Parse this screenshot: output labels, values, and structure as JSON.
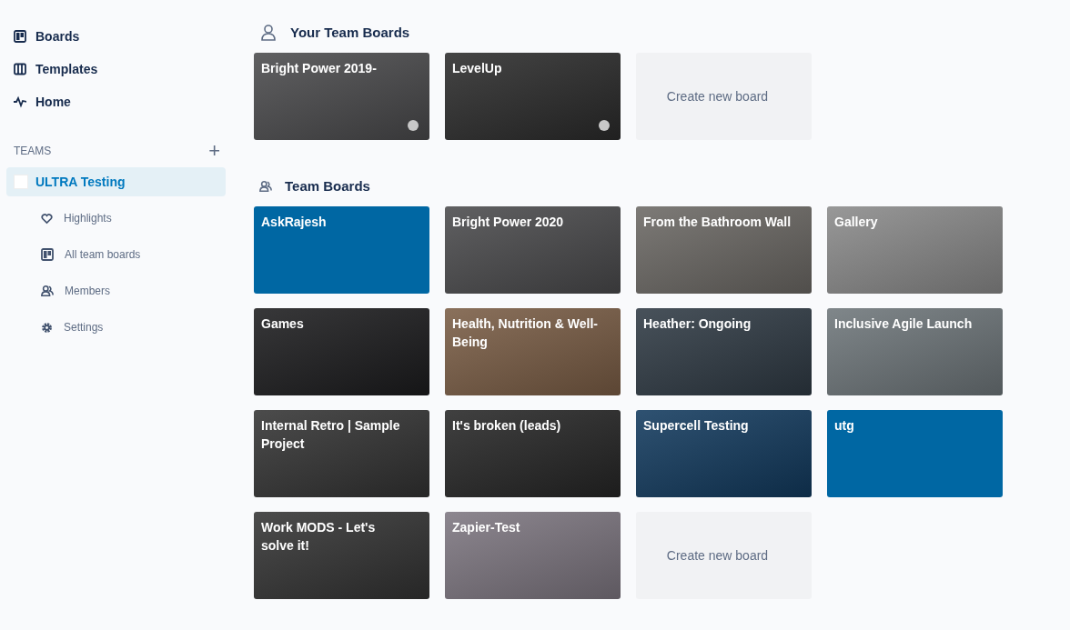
{
  "sidebar": {
    "nav": [
      {
        "label": "Boards"
      },
      {
        "label": "Templates"
      },
      {
        "label": "Home"
      }
    ],
    "teams_heading": "TEAMS",
    "add_symbol": "+",
    "team": {
      "name": "ULTRA Testing",
      "selected": true
    },
    "team_items": [
      {
        "label": "Highlights"
      },
      {
        "label": "All team boards"
      },
      {
        "label": "Members"
      },
      {
        "label": "Settings"
      }
    ]
  },
  "sections": [
    {
      "title": "Your Team Boards",
      "boards": [
        {
          "kind": "photo",
          "title": "Bright Power 2019-",
          "color": "#4a4a4c",
          "dot": true
        },
        {
          "kind": "photo",
          "title": "LevelUp",
          "color": "#2b2b2b",
          "dot": true
        },
        {
          "kind": "create",
          "title": "Create new board",
          "dot": false
        }
      ]
    },
    {
      "title": "Team Boards",
      "boards": [
        {
          "kind": "solid",
          "title": "AskRajesh",
          "color": "#0067a3",
          "dot": false
        },
        {
          "kind": "photo",
          "title": "Bright Power 2020",
          "color": "#4a4a4c",
          "dot": false
        },
        {
          "kind": "photo",
          "title": "From the Bathroom Wall",
          "color": "#6b6864",
          "dot": false
        },
        {
          "kind": "photo",
          "title": "Gallery",
          "color": "#8a8a8a",
          "dot": false
        },
        {
          "kind": "photo",
          "title": "Games",
          "color": "#1c1c1e",
          "dot": false
        },
        {
          "kind": "photo",
          "title": "Health, Nutrition & Well-Being",
          "color": "#7a5d45",
          "dot": false
        },
        {
          "kind": "photo",
          "title": "Heather: Ongoing",
          "color": "#2f3a44",
          "dot": false
        },
        {
          "kind": "photo",
          "title": "Inclusive Agile Launch",
          "color": "#6e767a",
          "dot": false
        },
        {
          "kind": "photo",
          "title": "Internal Retro | Sample Project",
          "color": "#333333",
          "dot": false
        },
        {
          "kind": "photo",
          "title": "It's broken (leads)",
          "color": "#262626",
          "dot": false
        },
        {
          "kind": "photo",
          "title": "Supercell Testing",
          "color": "#123a5e",
          "dot": false
        },
        {
          "kind": "solid",
          "title": "utg",
          "color": "#0067a3",
          "dot": false
        },
        {
          "kind": "photo",
          "title": "Work MODS - Let's solve it!",
          "color": "#333333",
          "dot": false
        },
        {
          "kind": "photo",
          "title": "Zapier-Test",
          "color": "#7d7680",
          "dot": false
        },
        {
          "kind": "create",
          "title": "Create new board",
          "dot": false
        }
      ]
    }
  ]
}
